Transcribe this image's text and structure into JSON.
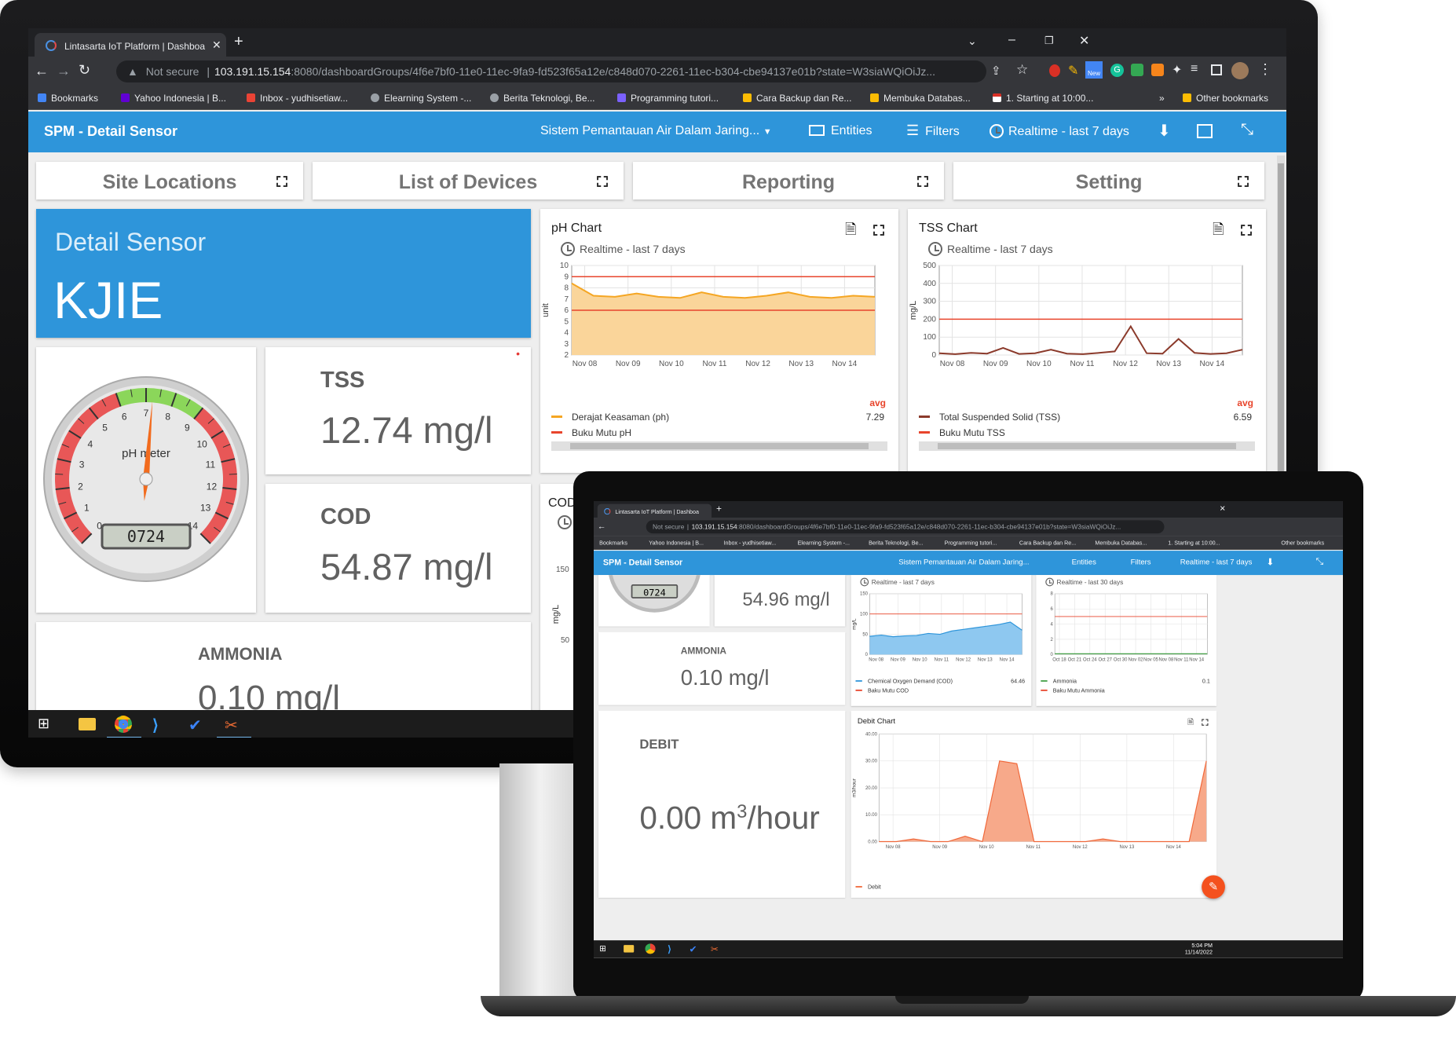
{
  "browser": {
    "tab_title": "Lintasarta IoT Platform | Dashboa",
    "security": "Not secure",
    "url_host": "103.191.15.154",
    "url_rest": ":8080/dashboardGroups/4f6e7bf0-11e0-11ec-9fa9-fd523f65a12e/c848d070-2261-11ec-b304-cbe94137e01b?state=W3siaWQiOiJz...",
    "bookmarks": [
      "Bookmarks",
      "Yahoo Indonesia | B...",
      "Inbox - yudhisetiaw...",
      "Elearning System -...",
      "Berita Teknologi, Be...",
      "Programming tutori...",
      "Cara Backup dan Re...",
      "Membuka Databas...",
      "1. Starting at 10:00..."
    ],
    "other_bookmarks": "Other bookmarks",
    "new_badge": "New"
  },
  "app": {
    "title": "SPM - Detail Sensor",
    "dashboard_selector": "Sistem Pemantauan Air Dalam Jaring...",
    "entities": "Entities",
    "filters": "Filters",
    "timewindow": "Realtime - last 7 days"
  },
  "nav": [
    "Site Locations",
    "List of Devices",
    "Reporting",
    "Setting"
  ],
  "detail": {
    "label": "Detail Sensor",
    "site": "KJIE"
  },
  "gauge": {
    "label": "pH meter",
    "value": 7.24,
    "display": "0724",
    "min": 0,
    "max": 14,
    "ticks": [
      "0",
      "1",
      "2",
      "3",
      "4",
      "5",
      "6",
      "7",
      "8",
      "9",
      "10",
      "11",
      "12",
      "13",
      "14"
    ]
  },
  "values": {
    "tss": {
      "title": "TSS",
      "value": "12.74 mg/l"
    },
    "cod": {
      "title": "COD",
      "value": "54.87 mg/l"
    },
    "ammonia": {
      "title": "AMMONIA",
      "value": "0.10 mg/l"
    }
  },
  "ph_chart": {
    "title": "pH Chart",
    "subtitle": "Realtime - last 7 days",
    "ylabel": "unit",
    "avg_label": "avg",
    "series": [
      {
        "name": "Derajat Keasaman (ph)",
        "avg": "7.29",
        "color": "#f5a623"
      },
      {
        "name": "Buku Mutu pH",
        "color": "#e8452c"
      }
    ]
  },
  "tss_chart": {
    "title": "TSS Chart",
    "subtitle": "Realtime - last 7 days",
    "ylabel": "mg/L",
    "avg_label": "avg",
    "series": [
      {
        "name": "Total Suspended Solid (TSS)",
        "avg": "6.59",
        "color": "#8b3a2b"
      },
      {
        "name": "Buku Mutu TSS",
        "color": "#e8452c"
      }
    ]
  },
  "cod_partial": {
    "title": "COD"
  },
  "chart_data": [
    {
      "type": "line",
      "title": "pH Chart",
      "ylabel": "unit",
      "x": [
        "Nov 08",
        "Nov 09",
        "Nov 10",
        "Nov 11",
        "Nov 12",
        "Nov 13",
        "Nov 14"
      ],
      "ylim": [
        2,
        10
      ],
      "yticks": [
        2,
        3,
        4,
        5,
        6,
        7,
        8,
        9,
        10
      ],
      "series": [
        {
          "name": "Derajat Keasaman (ph)",
          "values": [
            8.4,
            7.3,
            7.2,
            7.5,
            7.2,
            7.1,
            7.6,
            7.2,
            7.1,
            7.3,
            7.6,
            7.2,
            7.1,
            7.3,
            7.2
          ]
        },
        {
          "name": "Buku Mutu pH",
          "values": [
            9,
            9
          ]
        },
        {
          "name": "Buku Mutu pH",
          "values": [
            6,
            6
          ]
        }
      ]
    },
    {
      "type": "line",
      "title": "TSS Chart",
      "ylabel": "mg/L",
      "x": [
        "Nov 08",
        "Nov 09",
        "Nov 10",
        "Nov 11",
        "Nov 12",
        "Nov 13",
        "Nov 14"
      ],
      "ylim": [
        0,
        500
      ],
      "yticks": [
        0,
        100,
        200,
        300,
        400,
        500
      ],
      "series": [
        {
          "name": "Total Suspended Solid (TSS)",
          "values": [
            10,
            5,
            12,
            8,
            40,
            6,
            10,
            30,
            8,
            5,
            12,
            20,
            160,
            10,
            8,
            90,
            12,
            6,
            10,
            30
          ]
        },
        {
          "name": "Buku Mutu TSS",
          "values": [
            200,
            200
          ]
        }
      ]
    },
    {
      "type": "area",
      "title": "COD",
      "ylabel": "mg/L",
      "x": [
        "Nov 08",
        "Nov 09",
        "Nov 10",
        "Nov 11",
        "Nov 12",
        "Nov 13",
        "Nov 14"
      ],
      "ylim": [
        0,
        150
      ],
      "yticks": [
        0,
        50,
        100,
        150
      ],
      "series": [
        {
          "name": "Chemical Oxygen Demand (COD)",
          "values": [
            45,
            48,
            44,
            46,
            47,
            52,
            50,
            58,
            62,
            66,
            70,
            74,
            80,
            60
          ],
          "avg": "64.46"
        },
        {
          "name": "Baku Mutu COD",
          "values": [
            100,
            100
          ]
        }
      ]
    },
    {
      "type": "line",
      "title": "Ammonia",
      "x": [
        "Oct 18",
        "Oct 21",
        "Oct 24",
        "Oct 27",
        "Oct 30",
        "Nov 02",
        "Nov 05",
        "Nov 08",
        "Nov 11",
        "Nov 14"
      ],
      "ylim": [
        0,
        8
      ],
      "yticks": [
        0,
        2,
        4,
        6,
        8
      ],
      "series": [
        {
          "name": "Ammonia",
          "values": [
            0.1,
            0.1
          ],
          "avg": "0.1"
        },
        {
          "name": "Baku Mutu Ammonia",
          "values": [
            5,
            5
          ]
        }
      ]
    },
    {
      "type": "area",
      "title": "Debit Chart",
      "ylabel": "m3/hour",
      "x": [
        "Nov 08",
        "Nov 09",
        "Nov 10",
        "Nov 11",
        "Nov 12",
        "Nov 13",
        "Nov 14"
      ],
      "ylim": [
        0,
        40
      ],
      "yticks": [
        "0.00",
        "10.00",
        "20.00",
        "30.00",
        "40.00"
      ],
      "series": [
        {
          "name": "Debit",
          "values": [
            0,
            0,
            1,
            0,
            0,
            2,
            0,
            30,
            29,
            0,
            0,
            0,
            0,
            1,
            0,
            0,
            0,
            0,
            0,
            30
          ]
        }
      ]
    }
  ],
  "laptop": {
    "cod_value": "54.96 mg/l",
    "ammonia_title": "AMMONIA",
    "ammonia_value": "0.10 mg/l",
    "debit_title": "DEBIT",
    "debit_value": "0.00 m",
    "debit_unit_sup": "3",
    "debit_unit": "/hour",
    "cod_subtitle": "Realtime - last 7 days",
    "ammonia_subtitle": "Realtime - last 30 days",
    "cod_legend": "Chemical Oxygen Demand (COD)",
    "cod_legend2": "Baku Mutu COD",
    "cod_avg": "64.46",
    "ammonia_legend": "Ammonia",
    "ammonia_legend2": "Baku Mutu Ammonia",
    "ammonia_avg": "0.1",
    "debit_chart_title": "Debit Chart",
    "debit_legend": "Debit",
    "clock_time": "5:04 PM",
    "clock_date": "11/14/2022"
  }
}
